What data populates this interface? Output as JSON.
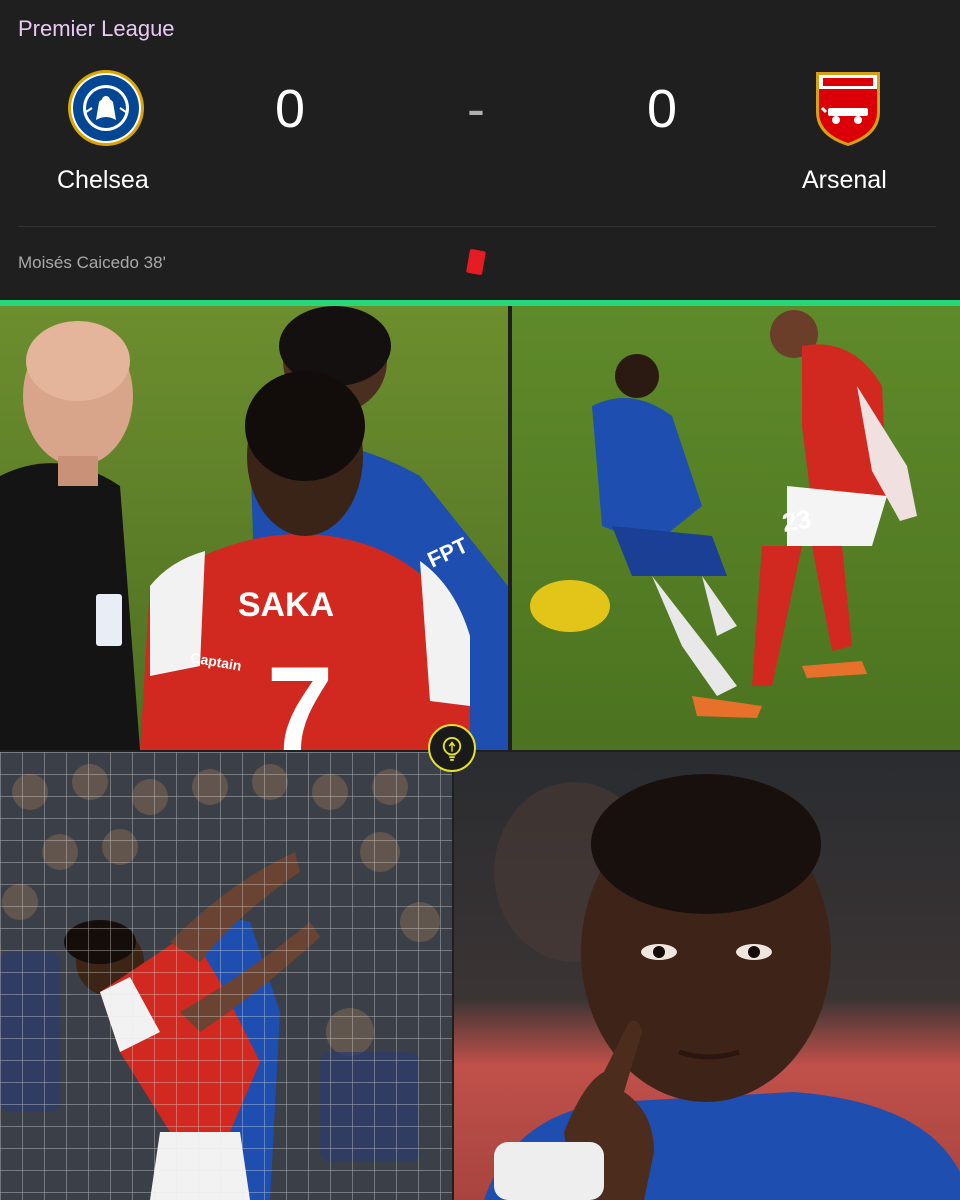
{
  "league": "Premier League",
  "home": {
    "name": "Chelsea",
    "score": "0",
    "crest": "chelsea-crest-icon",
    "color": "#034694"
  },
  "away": {
    "name": "Arsenal",
    "score": "0",
    "crest": "arsenal-crest-icon",
    "color": "#db0007"
  },
  "separator": "-",
  "event": {
    "text": "Moisés Caicedo 38'",
    "icon": "red-card-icon",
    "color": "#e51c23"
  },
  "accent_color": "#27d87a",
  "photos": {
    "referee_scene": {
      "shirt_name": "SAKA",
      "shirt_number": "7",
      "sleeve_badge": "Captain",
      "sponsor": "FPT"
    },
    "tackle_scene": {
      "shirt_number": "23"
    },
    "reaction_scene": {},
    "closeup_scene": {}
  },
  "watermark_icon": "lightbulb-logo-icon"
}
